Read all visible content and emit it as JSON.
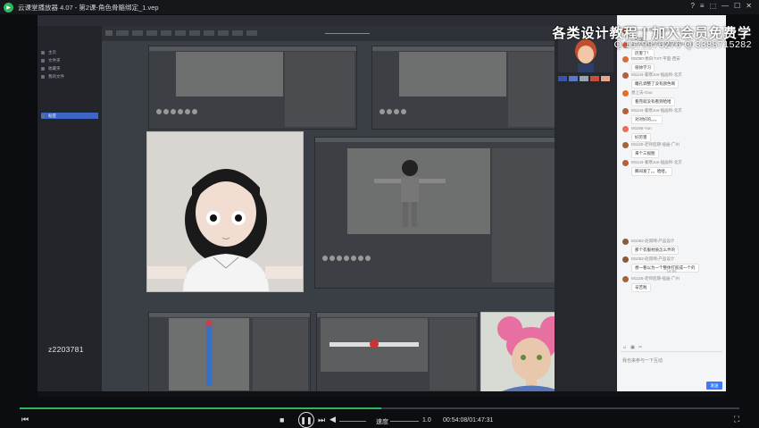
{
  "player": {
    "title": "云课堂播放器 4.07 - 第2课-角色骨骼绑定_1.vep",
    "speed_label": "速度",
    "speed_value": "1.0",
    "time": "00:54:08/01:47:31",
    "progress": 0.503
  },
  "watermark": {
    "line1": "各类设计教程 | 加入会员免费学",
    "line2": "Q:1579976276  Q:3388715282"
  },
  "sidebar": {
    "user_id": "z2203781",
    "items": [
      "主页",
      "文件夹",
      "收藏夹",
      "我的文件",
      "标签"
    ]
  },
  "chat": {
    "placeholder": "我也来参与一下互动",
    "send_label": "发送",
    "time_divider": "19:55",
    "messages": [
      {
        "name": "M1144-秦寒Joe-插画师-北京",
        "text": "好强"
      },
      {
        "name": "M1122-ArcherCC-平面设计师-上海",
        "text": "厉害了！"
      },
      {
        "name": "M1090-易白 FXT-平面-西安",
        "text": "很帅学习"
      },
      {
        "name": "M1144-秦寒Joe-插画师-北京",
        "text": "瞳孔调整了没有颜色啊"
      },
      {
        "name": "想上去-Gou",
        "text": "看完就没有看到哈哈"
      },
      {
        "name": "M1144-秦寒Joe-插画师-北京",
        "text": "对对好的。。。"
      },
      {
        "name": "M1196-Yun",
        "text": "好厉害"
      },
      {
        "name": "M1125-老师后期-插画-广州",
        "text": "来个三视图"
      },
      {
        "name": "M1144-秦寒Joe-插画师-北京",
        "text": "瞬间发了。。哈哈。"
      },
      {
        "name": "M1062-赵雨晴-产品设计",
        "text": "那个衣服材质怎么弄的"
      },
      {
        "name": "M1062-赵雨晴-产品设计",
        "text": "想一看以为一个整体打胶成一个的"
      },
      {
        "name": "M1125-老师后期-插画-广州",
        "text": "辛苦啦"
      }
    ]
  },
  "colors": {
    "accent": "#2fb55e",
    "send": "#3a7afe",
    "chat_bg": "#f4f5f7"
  }
}
